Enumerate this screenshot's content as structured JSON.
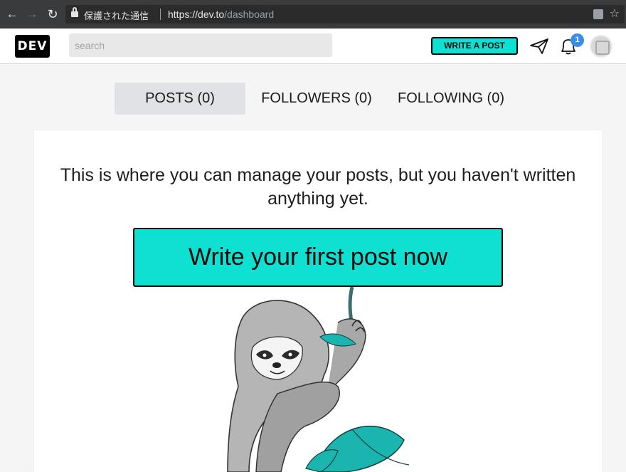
{
  "browser": {
    "nav": {
      "back": "←",
      "forward": "→",
      "reload": "↻"
    },
    "security_label": "保護された通信",
    "url_scheme": "https://",
    "url_host": "dev.to",
    "url_path": "/dashboard",
    "star": "☆"
  },
  "header": {
    "logo": "DEV",
    "search_placeholder": "search",
    "write_post_label": "WRITE A POST",
    "notification_count": "1",
    "icons": [
      "send-icon",
      "bell-icon",
      "avatar"
    ]
  },
  "tabs": [
    {
      "label": "POSTS (0)",
      "active": true
    },
    {
      "label": "FOLLOWERS (0)",
      "active": false
    },
    {
      "label": "FOLLOWING (0)",
      "active": false
    }
  ],
  "main": {
    "empty_message": "This is where you can manage your posts, but you haven't written anything yet.",
    "cta_label": "Write your first post now"
  },
  "colors": {
    "accent": "#0ee1d2",
    "dark": "#0a0a0a",
    "badge": "#3b8ce8",
    "leaf": "#1bb5b0"
  }
}
